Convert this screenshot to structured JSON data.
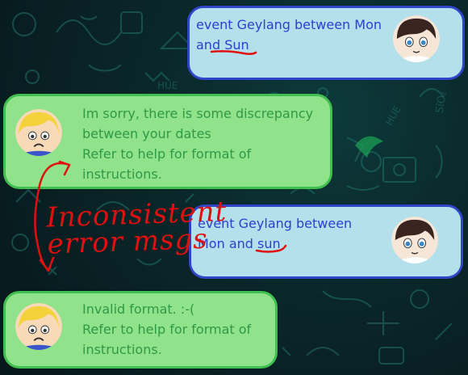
{
  "chat": {
    "messages": [
      {
        "sender": "user",
        "text": "event Geylang between Mon\nand Sun"
      },
      {
        "sender": "bot",
        "text": "Im sorry, there is some discrepancy\nbetween your dates\nRefer to help for format of\ninstructions."
      },
      {
        "sender": "user",
        "text": "event Geylang between\nMon and sun"
      },
      {
        "sender": "bot",
        "text": "Invalid format. :-(\nRefer to help for format of\ninstructions."
      }
    ]
  },
  "annotation": {
    "text": "Inconsistent error msgs",
    "color": "#e01010"
  },
  "colors": {
    "user_bubble": "#b3e0ea",
    "user_border": "#2f46c9",
    "user_text": "#2c3fd0",
    "bot_bubble": "#90e38a",
    "bot_border": "#3fbf4f",
    "bot_text": "#2f9948"
  }
}
